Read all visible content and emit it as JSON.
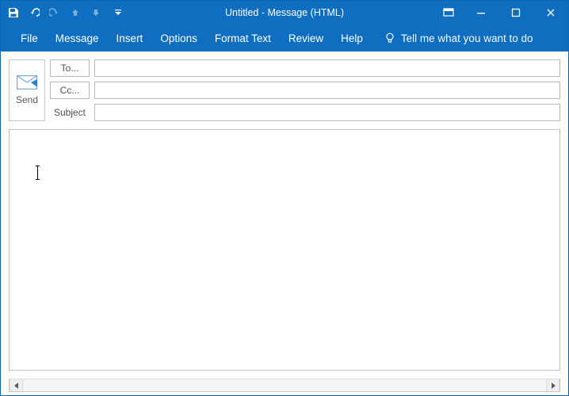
{
  "title": "Untitled  -  Message (HTML)",
  "ribbon": {
    "tabs": [
      "File",
      "Message",
      "Insert",
      "Options",
      "Format Text",
      "Review",
      "Help"
    ],
    "tell_me": "Tell me what you want to do"
  },
  "compose": {
    "send_label": "Send",
    "to_label": "To...",
    "cc_label": "Cc...",
    "subject_label": "Subject",
    "to_value": "",
    "cc_value": "",
    "subject_value": "",
    "body_value": ""
  }
}
